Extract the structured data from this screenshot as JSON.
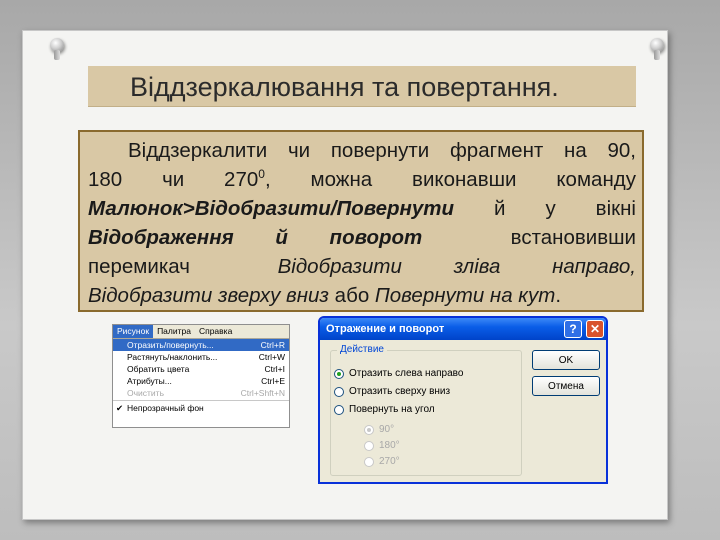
{
  "slide": {
    "title": "Віддзеркалювання та повертання.",
    "body": {
      "line1": [
        "Віддзеркалити",
        "чи",
        "повернути",
        "фрагмент",
        "на",
        "90,"
      ],
      "line2_a": "180",
      "line2_b": "чи",
      "line2_c": "270",
      "line2_sup": "0",
      "line2_d": ",",
      "line2_e": "можна",
      "line2_f": "виконавши",
      "line2_g": "команду",
      "line3_cmd": "Малюнок>Відобразити/Повернути",
      "line3_a": "й",
      "line3_b": "у",
      "line3_c": "вікні",
      "line4_window": "Відображення й поворот",
      "line4_a": "встановивши",
      "line5_a": "перемикач",
      "line5_opt": "Відобразити зліва направо,",
      "line6_opt1": "Відобразити зверху вниз",
      "line6_or": "або",
      "line6_opt2": "Повернути на кут",
      "line6_end": "."
    }
  },
  "menu": {
    "bar": [
      "Рисунок",
      "Палитра",
      "Справка"
    ],
    "items": [
      {
        "label": "Отразить/повернуть...",
        "shortcut": "Ctrl+R"
      },
      {
        "label": "Растянуть/наклонить...",
        "shortcut": "Ctrl+W"
      },
      {
        "label": "Обратить цвета",
        "shortcut": "Ctrl+I"
      },
      {
        "label": "Атрибуты...",
        "shortcut": "Ctrl+E"
      },
      {
        "label": "Очистить",
        "shortcut": "Ctrl+Shft+N"
      },
      {
        "label": "Непрозрачный фон",
        "shortcut": ""
      }
    ]
  },
  "dialog": {
    "title": "Отражение и поворот",
    "help": "?",
    "close": "✕",
    "group": "Действие",
    "options": [
      "Отразить слева направо",
      "Отразить сверху вниз",
      "Повернуть на угол"
    ],
    "angles": [
      "90°",
      "180°",
      "270°"
    ],
    "ok": "OK",
    "cancel": "Отмена"
  }
}
